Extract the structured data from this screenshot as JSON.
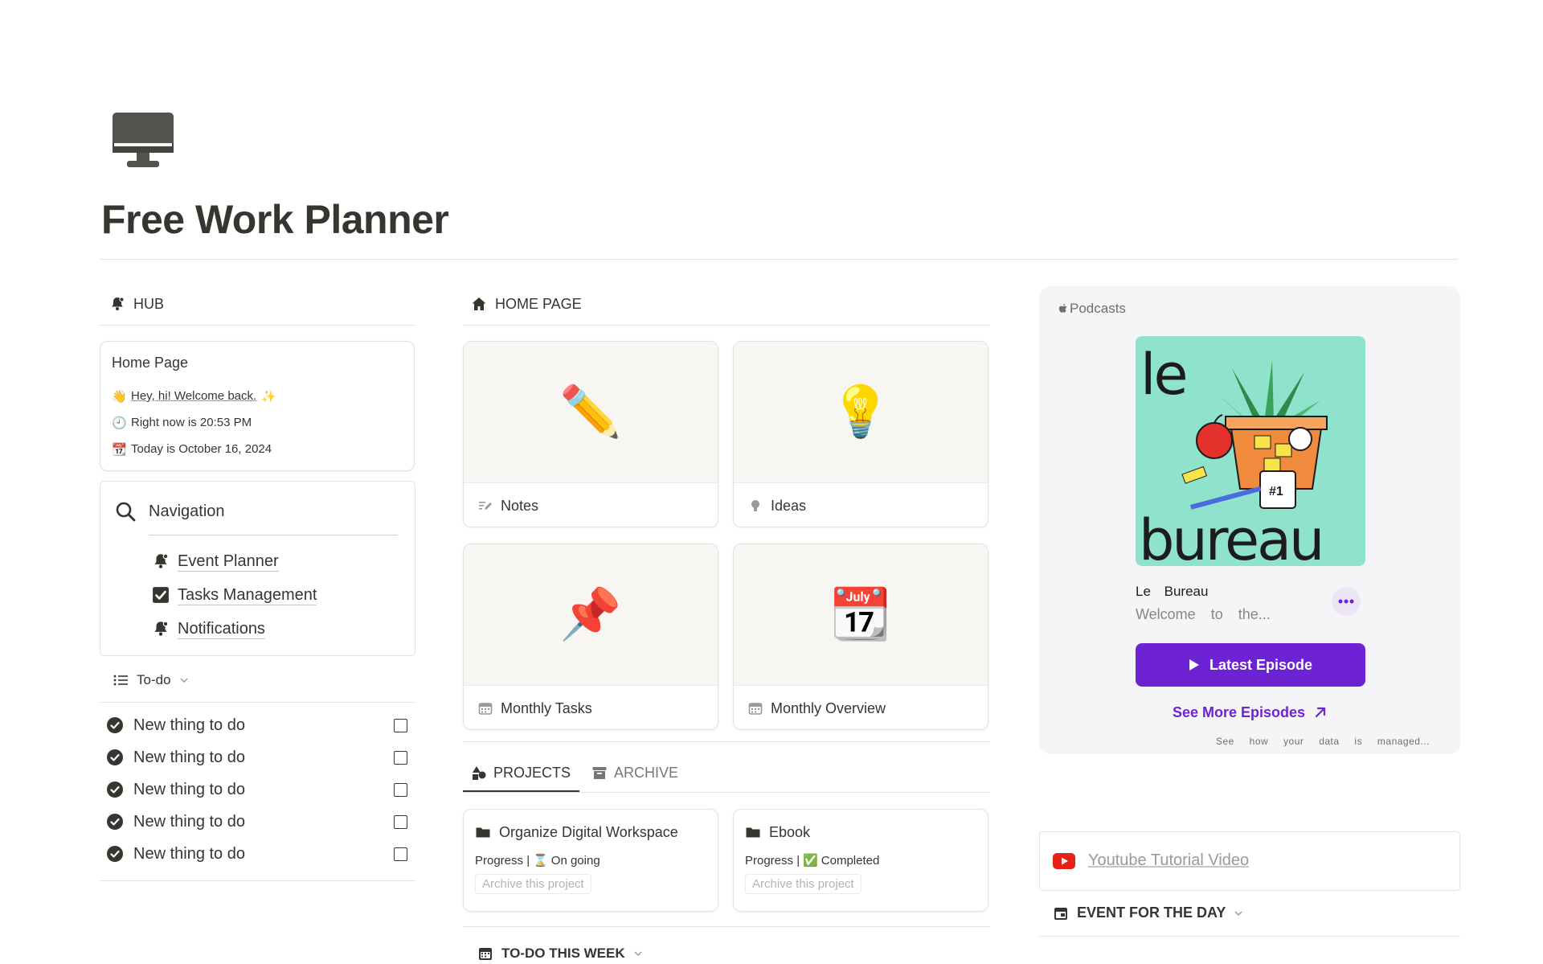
{
  "page": {
    "title": "Free Work Planner",
    "icon": "desktop-computer-icon"
  },
  "hub": {
    "heading": "HUB",
    "home_card": {
      "title": "Home Page",
      "greeting": "Hey, hi! Welcome back.",
      "time_line": "Right now is 20:53 PM",
      "date_line": "Today is October 16, 2024"
    },
    "navigation": {
      "title": "Navigation",
      "items": [
        {
          "label": "Event Planner",
          "icon": "bell-icon"
        },
        {
          "label": "Tasks Management",
          "icon": "checkbox-icon"
        },
        {
          "label": "Notifications",
          "icon": "bell-icon"
        }
      ]
    },
    "todo": {
      "heading": "To-do",
      "items": [
        {
          "label": "New thing to do",
          "checked": false
        },
        {
          "label": "New thing to do",
          "checked": false
        },
        {
          "label": "New thing to do",
          "checked": false
        },
        {
          "label": "New thing to do",
          "checked": false
        },
        {
          "label": "New thing to do",
          "checked": false
        }
      ]
    }
  },
  "home": {
    "heading": "HOME PAGE",
    "tiles": [
      {
        "label": "Notes",
        "emoji": "✏️",
        "icon": "pencil-lines-icon"
      },
      {
        "label": "Ideas",
        "emoji": "💡",
        "icon": "lightbulb-icon"
      },
      {
        "label": "Monthly Tasks",
        "emoji": "📌",
        "icon": "calendar-icon"
      },
      {
        "label": "Monthly Overview",
        "emoji": "📆",
        "icon": "calendar-icon"
      }
    ],
    "tabs": [
      {
        "label": "PROJECTS",
        "active": true,
        "icon": "shapes-icon"
      },
      {
        "label": "ARCHIVE",
        "active": false,
        "icon": "archive-box-icon"
      }
    ],
    "projects": [
      {
        "title": "Organize Digital Workspace",
        "progress_label": "Progress |",
        "status_emoji": "⌛",
        "status": "On going",
        "archive_label": "Archive this project"
      },
      {
        "title": "Ebook",
        "progress_label": "Progress |",
        "status_emoji": "✅",
        "status": "Completed",
        "archive_label": "Archive this project"
      }
    ],
    "week_heading": "TO-DO THIS WEEK"
  },
  "podcast": {
    "source": "Podcasts",
    "show_name": "Le Bureau",
    "description": "Welcome to the...",
    "art_text_top": "le",
    "art_text_bottom": "bureau",
    "latest_button": "Latest Episode",
    "see_more": "See More Episodes",
    "data_note": "See how your data is managed...",
    "accent": "#6d22d4"
  },
  "youtube": {
    "label": "Youtube Tutorial Video"
  },
  "event": {
    "heading": "EVENT FOR THE DAY"
  }
}
